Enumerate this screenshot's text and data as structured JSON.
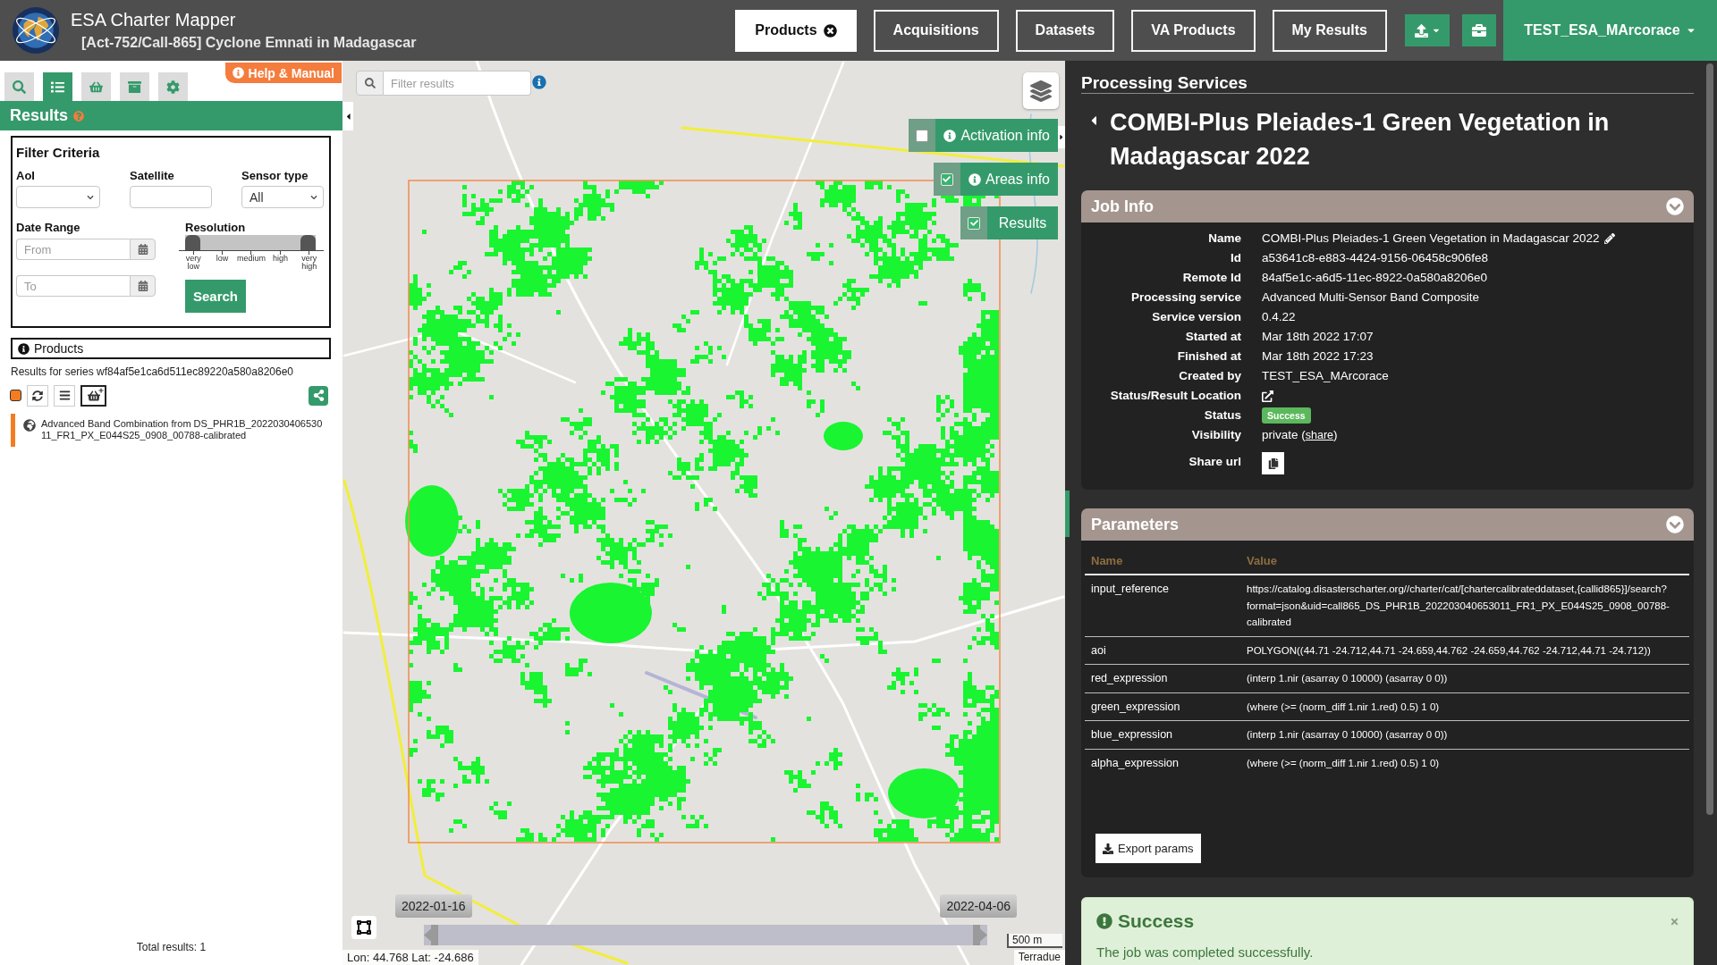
{
  "header": {
    "title": "ESA Charter Mapper",
    "subtitle": "[Act-752/Call-865] Cyclone Emnati in Madagascar"
  },
  "nav": {
    "tabs": [
      {
        "label": "Products",
        "selected": true,
        "closable": true
      },
      {
        "label": "Acquisitions",
        "selected": false,
        "closable": false
      },
      {
        "label": "Datasets",
        "selected": false,
        "closable": false
      },
      {
        "label": "VA Products",
        "selected": false,
        "closable": false
      },
      {
        "label": "My Results",
        "selected": false,
        "closable": false
      }
    ],
    "user": "TEST_ESA_MArcorace"
  },
  "sidebar": {
    "tabs": [
      {
        "selected": false
      },
      {
        "selected": true
      },
      {
        "selected": false
      },
      {
        "selected": false
      },
      {
        "selected": false
      }
    ],
    "help_button": "Help & Manual",
    "section_title": "Results",
    "filter": {
      "title": "Filter Criteria",
      "aoi": {
        "label": "AoI"
      },
      "satellite": {
        "label": "Satellite"
      },
      "sensor_type": {
        "label": "Sensor type",
        "value": "All"
      },
      "date_range": {
        "label": "Date Range",
        "from": {
          "placeholder": "From"
        },
        "to": {
          "placeholder": "To"
        }
      },
      "resolution": {
        "label": "Resolution",
        "level": 1,
        "ticks": [
          "very low",
          "low",
          "medium",
          "high",
          "very high"
        ]
      },
      "search_button": "Search"
    },
    "products": {
      "title": "Products",
      "series": "Results for series wf84af5e1ca6d511ec89220a580a8206e0",
      "items": [
        {
          "label": "Advanced Band Combination from DS_PHR1B_202203040653011_FR1_PX_E044S25_0908_00788-calibrated",
          "selected": true
        }
      ],
      "total": "Total results: 1"
    }
  },
  "map": {
    "search": {
      "placeholder": "Filter results"
    },
    "layers": [
      {
        "label": "Activation info",
        "checked": false,
        "info": true
      },
      {
        "label": "Areas info",
        "checked": true,
        "info": true
      },
      {
        "label": "Results",
        "checked": true,
        "info": false
      }
    ],
    "timeline": {
      "start": "2022-01-16",
      "end": "2022-04-06",
      "level": 1
    },
    "scale": "500 m",
    "coordinates": "Lon: 44.768 Lat: -24.686",
    "attribution": "Terradue"
  },
  "details": {
    "section_title": "Processing Services",
    "title": "COMBI-Plus Pleiades-1 Green Vegetation in Madagascar 2022",
    "job_info": {
      "title": "Job Info",
      "expanded": true,
      "rows": [
        {
          "label": "Name",
          "kind": "editable",
          "value": "COMBI-Plus Pleiades-1 Green Vegetation in Madagascar 2022"
        },
        {
          "label": "Id",
          "kind": "text",
          "value": "a53641c8-e883-4424-9156-06458c906fe8"
        },
        {
          "label": "Remote Id",
          "kind": "text",
          "value": "84af5e1c-a6d5-11ec-8922-0a580a8206e0"
        },
        {
          "label": "Processing service",
          "kind": "text",
          "value": "Advanced Multi-Sensor Band Composite"
        },
        {
          "label": "Service version",
          "kind": "text",
          "value": "0.4.22"
        },
        {
          "label": "Started at",
          "kind": "text",
          "value": "Mar 18th 2022 17:07"
        },
        {
          "label": "Finished at",
          "kind": "text",
          "value": "Mar 18th 2022 17:23"
        },
        {
          "label": "Created by",
          "kind": "text",
          "value": "TEST_ESA_MArcorace"
        },
        {
          "label": "Status/Result Location",
          "kind": "external-link"
        },
        {
          "label": "Status",
          "kind": "badge",
          "value": "Success"
        },
        {
          "label": "Visibility",
          "kind": "link-text",
          "before": "private (",
          "link": "share",
          "after": ")"
        },
        {
          "label": "Share url",
          "kind": "copy-button"
        }
      ]
    },
    "parameters": {
      "title": "Parameters",
      "expanded": true,
      "columns": [
        "Name",
        "Value"
      ],
      "rows": [
        {
          "name": "input_reference",
          "value": "https://catalog.disasterscharter.org//charter/cat/[chartercalibrateddataset,{callid865}]/search?format=json&uid=call865_DS_PHR1B_202203040653011_FR1_PX_E044S25_0908_00788-calibrated"
        },
        {
          "name": "aoi",
          "value": "POLYGON((44.71 -24.712,44.71 -24.659,44.762 -24.659,44.762 -24.712,44.71 -24.712))"
        },
        {
          "name": "red_expression",
          "value": "(interp 1.nir (asarray 0 10000) (asarray 0 0))"
        },
        {
          "name": "green_expression",
          "value": "(where (>= (norm_diff 1.nir 1.red) 0.5) 1 0)"
        },
        {
          "name": "blue_expression",
          "value": "(interp 1.nir (asarray 0 10000) (asarray 0 0))"
        },
        {
          "name": "alpha_expression",
          "value": "(where (>= (norm_diff 1.nir 1.red) 0.5) 1 0)"
        }
      ],
      "export_button": "Export params"
    },
    "alert": {
      "title": "Success",
      "message": "The job was completed successfully."
    }
  }
}
